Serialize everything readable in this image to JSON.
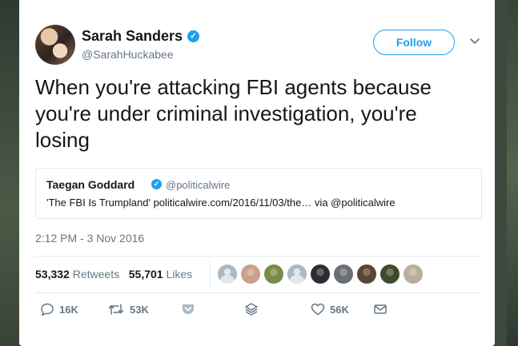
{
  "author": {
    "name": "Sarah Sanders",
    "handle": "@SarahHuckabee",
    "verified_glyph": "✓"
  },
  "follow_label": "Follow",
  "tweet_text": "When you're attacking FBI agents because you're under criminal investigation, you're losing",
  "quoted": {
    "name": "Taegan Goddard",
    "handle": "@politicalwire",
    "text": "'The FBI Is Trumpland' politicalwire.com/2016/11/03/the… via @politicalwire"
  },
  "timestamp": "2:12 PM - 3 Nov 2016",
  "stats": {
    "retweets_count": "53,332",
    "retweets_label": "Retweets",
    "likes_count": "55,701",
    "likes_label": "Likes"
  },
  "liker_faces": [
    {
      "name": "liker-1",
      "color": "#aab8c2"
    },
    {
      "name": "liker-2",
      "color": "#c9a08a"
    },
    {
      "name": "liker-3",
      "color": "#7a8a4a"
    },
    {
      "name": "liker-4",
      "color": "#aab8c2"
    },
    {
      "name": "liker-5",
      "color": "#2b2d33"
    },
    {
      "name": "liker-6",
      "color": "#6b6f74"
    },
    {
      "name": "liker-7",
      "color": "#5a4632"
    },
    {
      "name": "liker-8",
      "color": "#3f4a2a"
    },
    {
      "name": "liker-9",
      "color": "#b8ae9a"
    }
  ],
  "actions": {
    "reply_count": "16K",
    "retweet_count": "53K",
    "like_count": "56K"
  },
  "icons": {
    "reply": "reply-icon",
    "retweet": "retweet-icon",
    "pocket": "pocket-icon",
    "stack": "stack-icon",
    "like": "heart-icon",
    "message": "envelope-icon",
    "more": "chevron-down-icon"
  },
  "colors": {
    "accent": "#1da1f2",
    "text": "#14171a",
    "muted": "#657786",
    "pocket": "#aab8c2"
  }
}
